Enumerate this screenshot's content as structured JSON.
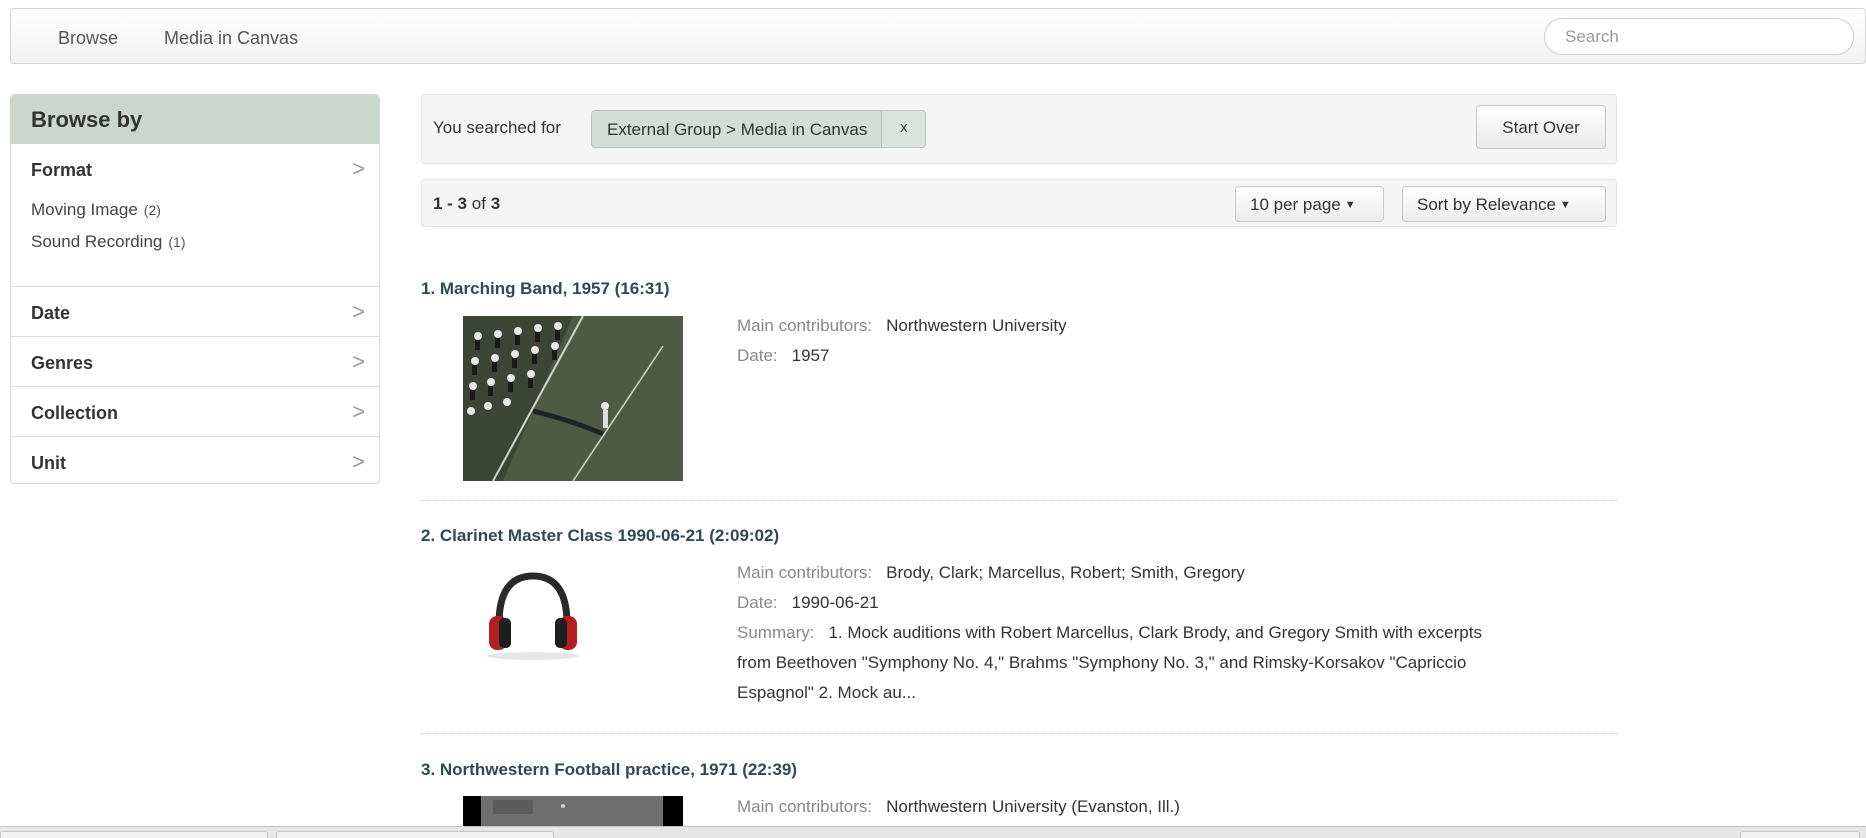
{
  "nav": {
    "links": [
      "Browse",
      "Media in Canvas"
    ],
    "search_placeholder": "Search"
  },
  "sidebar": {
    "heading": "Browse by",
    "facets": [
      {
        "label": "Format",
        "values": [
          {
            "label": "Moving Image",
            "count": "(2)"
          },
          {
            "label": "Sound Recording",
            "count": "(1)"
          }
        ]
      },
      {
        "label": "Date"
      },
      {
        "label": "Genres"
      },
      {
        "label": "Collection"
      },
      {
        "label": "Unit"
      }
    ],
    "chevron": ">"
  },
  "constraints": {
    "prefix": "You searched for",
    "filter_label": "External Group > Media in Canvas",
    "remove_label": "x",
    "start_over": "Start Over"
  },
  "results_header": {
    "range": "1 - 3",
    "of_word": "of",
    "total": "3",
    "per_page": "10 per page",
    "sort": "Sort by Relevance"
  },
  "results": [
    {
      "title": "1. Marching Band, 1957 (16:31)",
      "thumb": "marching-band-video-frame",
      "contributors_key": "Main contributors:",
      "contributors": "Northwestern University",
      "date_key": "Date:",
      "date": "1957"
    },
    {
      "title": "2. Clarinet Master Class 1990-06-21 (2:09:02)",
      "thumb": "headphones-icon",
      "contributors_key": "Main contributors:",
      "contributors": "Brody, Clark; Marcellus, Robert; Smith, Gregory",
      "date_key": "Date:",
      "date": "1990-06-21",
      "summary_key": "Summary:",
      "summary": "1. Mock auditions with Robert Marcellus, Clark Brody, and Gregory Smith with excerpts from Beethoven \"Symphony No. 4,\" Brahms \"Symphony No. 3,\" and Rimsky-Korsakov \"Capriccio Espagnol\" 2. Mock au..."
    },
    {
      "title": "3. Northwestern Football practice, 1971 (22:39)",
      "thumb": "football-practice-video-frame",
      "contributors_key": "Main contributors:",
      "contributors": "Northwestern University (Evanston, Ill.)"
    }
  ],
  "colors": {
    "sidebar_header_bg": "#ccd6cf",
    "link_title": "#2e4a52",
    "constraint_bg": "#d4ddd7"
  }
}
